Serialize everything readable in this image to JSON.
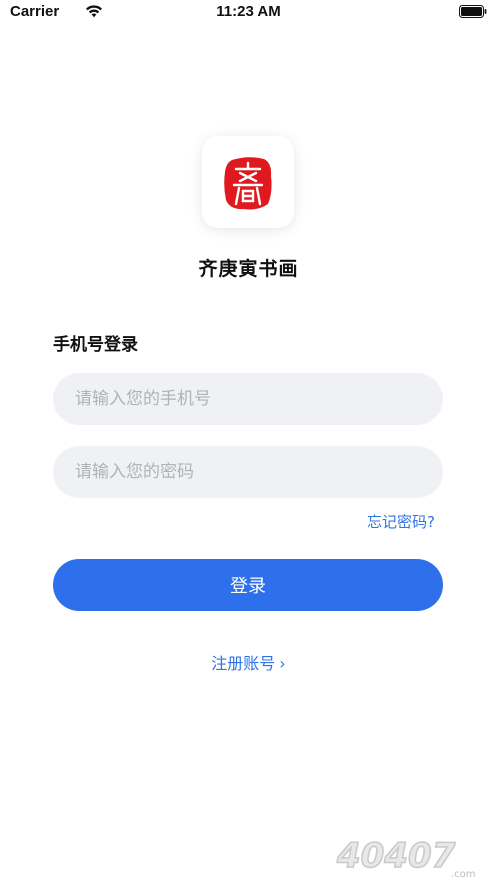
{
  "status_bar": {
    "carrier": "Carrier",
    "time": "11:23 AM"
  },
  "app": {
    "name": "齐庚寅书画",
    "logo_glyph": "齋",
    "logo_color": "#e0191e"
  },
  "login": {
    "section_title": "手机号登录",
    "phone_placeholder": "请输入您的手机号",
    "password_placeholder": "请输入您的密码",
    "forgot_label": "忘记密码?",
    "submit_label": "登录",
    "register_label": "注册账号",
    "register_chevron": "›"
  },
  "watermark": {
    "text": "40407",
    "suffix": ".com"
  },
  "colors": {
    "accent": "#2e70ec",
    "link": "#2f73e8",
    "field_bg": "#f0f1f4"
  }
}
